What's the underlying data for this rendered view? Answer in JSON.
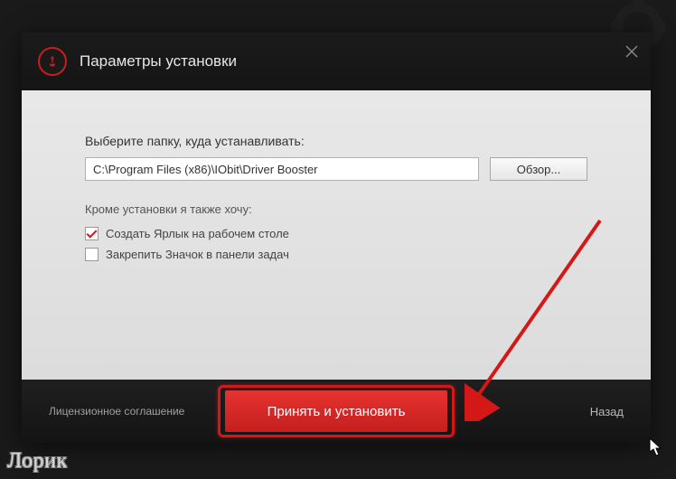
{
  "title": "Параметры установки",
  "content": {
    "select_folder_label": "Выберите папку, куда устанавливать:",
    "install_path": "C:\\Program Files (x86)\\IObit\\Driver Booster",
    "browse_label": "Обзор...",
    "additional_label": "Кроме установки я также хочу:",
    "options": [
      {
        "label": "Создать Ярлык на рабочем столе",
        "checked": true
      },
      {
        "label": "Закрепить Значок в панели задач",
        "checked": false
      }
    ]
  },
  "footer": {
    "license_label": "Лицензионное соглашение",
    "install_label": "Принять и установить",
    "back_label": "Назад"
  },
  "watermark": "Лорик",
  "colors": {
    "accent_red": "#d41818",
    "button_red": "#e83232"
  }
}
